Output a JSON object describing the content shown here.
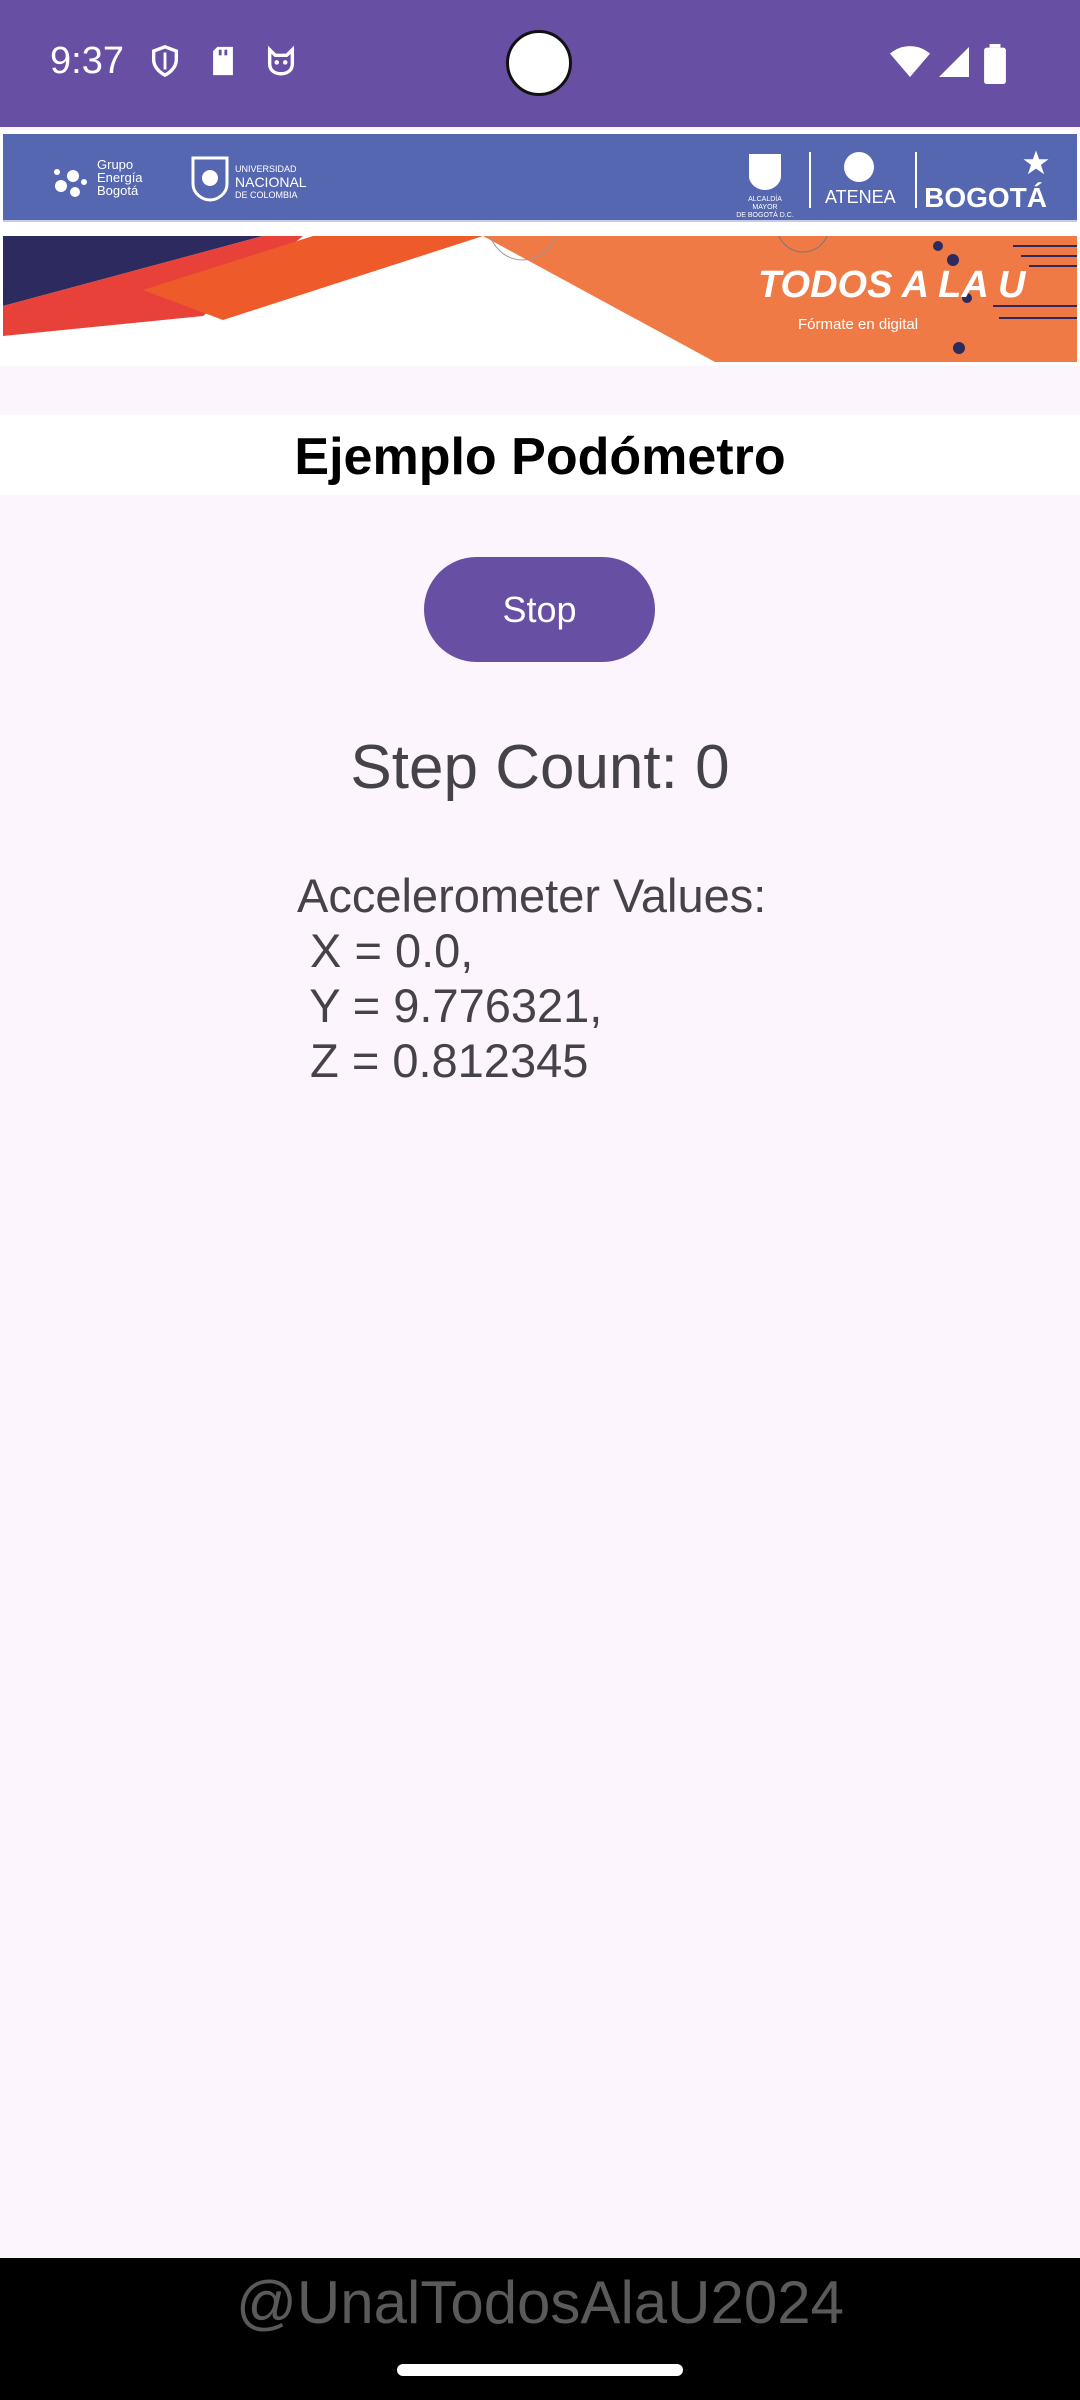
{
  "status_bar": {
    "time": "9:37",
    "left_icons": [
      "shield-icon",
      "sd-card-icon",
      "cat-face-icon"
    ],
    "right_icons": [
      "wifi-icon",
      "signal-icon",
      "battery-icon"
    ],
    "bg_color": "#6750a4"
  },
  "banner": {
    "logos": {
      "grupo_energia": [
        "Grupo",
        "Energía",
        "Bogotá"
      ],
      "universidad": [
        "UNIVERSIDAD",
        "NACIONAL",
        "DE COLOMBIA"
      ],
      "alcaldia": [
        "ALCALDÍA MAYOR",
        "DE BOGOTÁ D.C."
      ],
      "atenea": "ATENEA",
      "bogota": "BOGOTÁ"
    },
    "todos_title": "TODOS A LA U",
    "todos_subtitle": "Fórmate en digital"
  },
  "page": {
    "title": "Ejemplo Podómetro",
    "stop_label": "Stop",
    "step_count": "Step Count: 0",
    "accelerometer": {
      "heading": "Accelerometer Values:",
      "x": " X = 0.0,",
      "y": " Y = 9.776321,",
      "z": " Z = 0.812345"
    }
  },
  "watermark": "@UnalTodosAlaU2024",
  "colors": {
    "accent": "#6750a4",
    "background": "#fcf5fd",
    "text": "#45424a"
  }
}
